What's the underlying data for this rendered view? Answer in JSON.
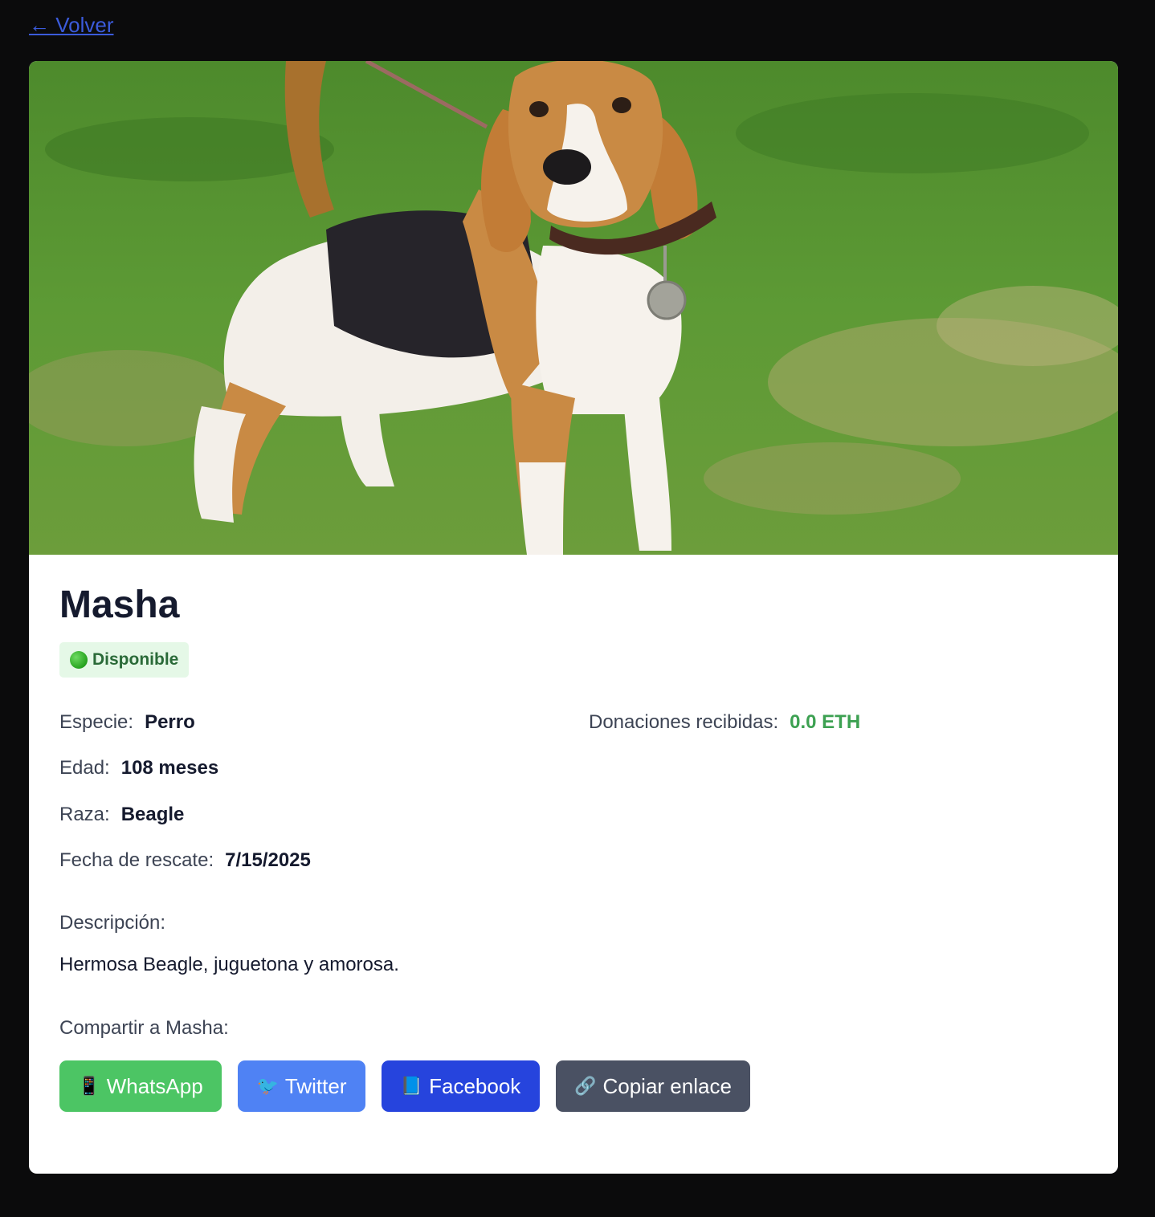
{
  "nav": {
    "back_label": "← Volver"
  },
  "pet": {
    "name": "Masha",
    "status": "Disponible",
    "status_color": "#2a6a38",
    "details": [
      {
        "label": "Especie:",
        "value": "Perro"
      },
      {
        "label": "Edad:",
        "value": "108 meses"
      },
      {
        "label": "Raza:",
        "value": "Beagle"
      },
      {
        "label": "Fecha de rescate:",
        "value": "7/15/2025"
      }
    ],
    "donations": {
      "label": "Donaciones recibidas:",
      "value": "0.0 ETH",
      "color": "#3da152"
    },
    "description_label": "Descripción:",
    "description": "Hermosa Beagle, juguetona y amorosa."
  },
  "share": {
    "label": "Compartir a Masha:",
    "buttons": [
      {
        "icon": "phone-icon",
        "label": "WhatsApp",
        "color": "#4cc564"
      },
      {
        "icon": "bird-icon",
        "label": "Twitter",
        "color": "#4f82f4"
      },
      {
        "icon": "book-icon",
        "label": "Facebook",
        "color": "#2644dd"
      },
      {
        "icon": "link-icon",
        "label": "Copiar enlace",
        "color": "#4a5163"
      }
    ]
  }
}
